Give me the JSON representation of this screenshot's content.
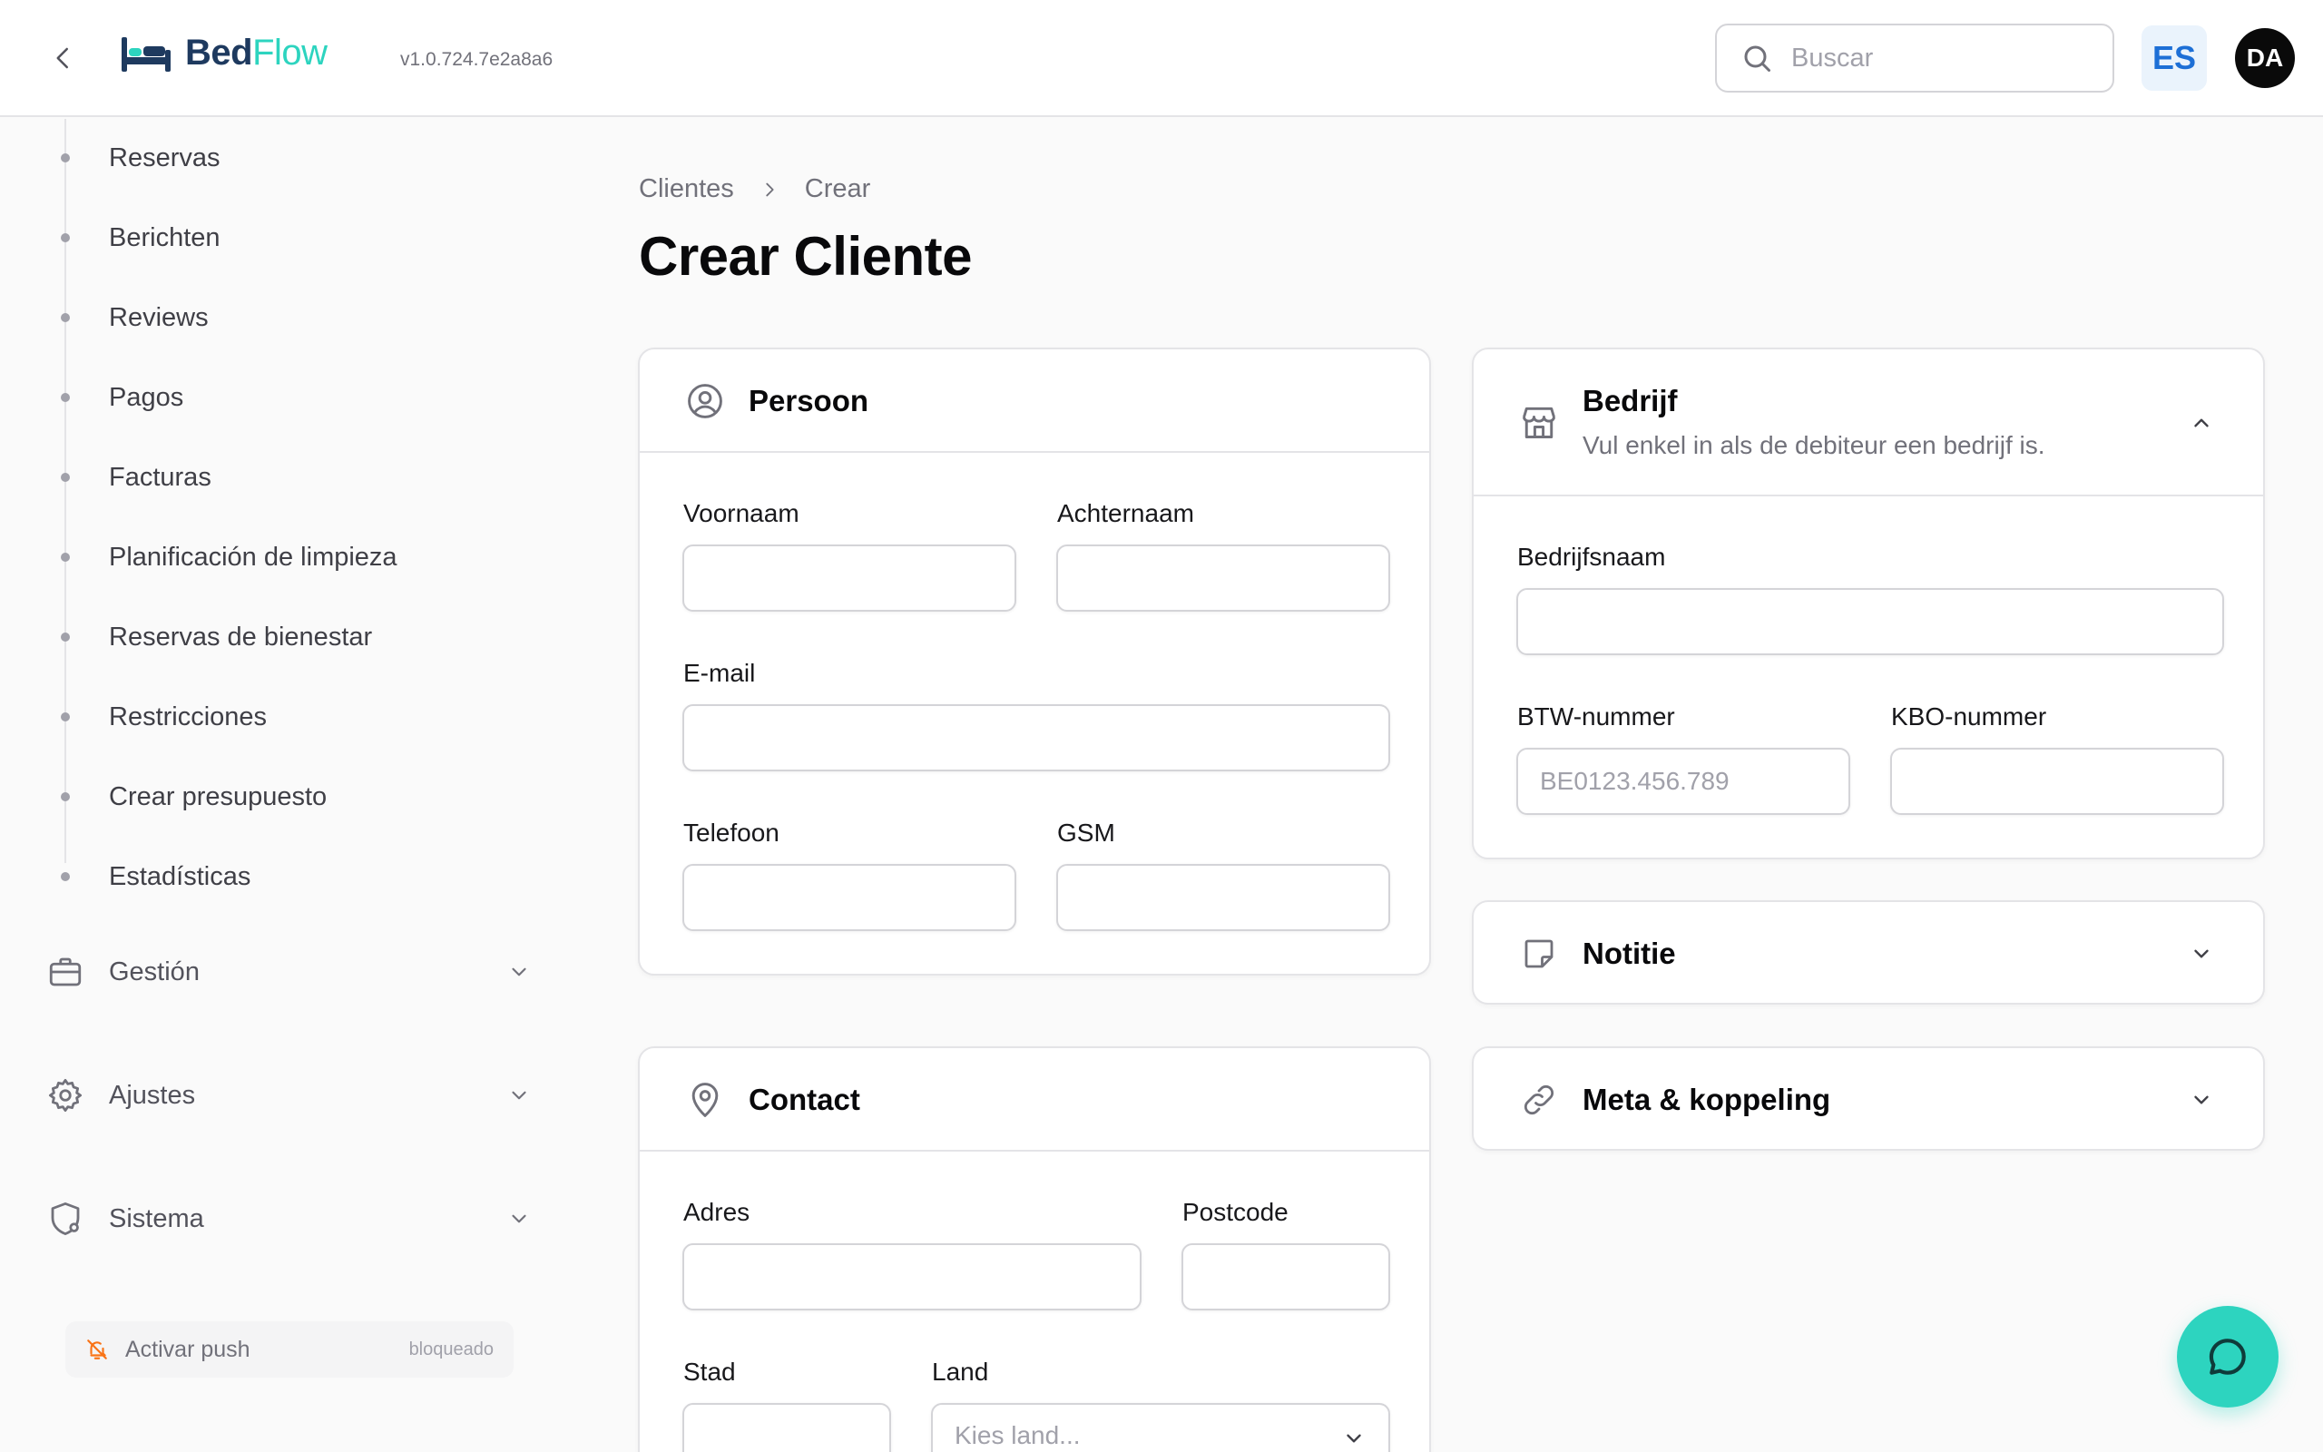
{
  "header": {
    "logo_part1": "Bed",
    "logo_part2": "Flow",
    "version": "v1.0.724.7e2a8a6",
    "search_placeholder": "Buscar",
    "language": "ES",
    "user_initials": "DA"
  },
  "sidebar": {
    "sub_items": [
      {
        "label": "Reservas"
      },
      {
        "label": "Berichten"
      },
      {
        "label": "Reviews"
      },
      {
        "label": "Pagos"
      },
      {
        "label": "Facturas"
      },
      {
        "label": "Planificación de limpieza"
      },
      {
        "label": "Reservas de bienestar"
      },
      {
        "label": "Restricciones"
      },
      {
        "label": "Crear presupuesto"
      },
      {
        "label": "Estadísticas"
      }
    ],
    "groups": [
      {
        "label": "Gestión",
        "icon": "briefcase-icon"
      },
      {
        "label": "Ajustes",
        "icon": "gear-icon"
      },
      {
        "label": "Sistema",
        "icon": "shield-gear-icon"
      }
    ],
    "push": {
      "label": "Activar push",
      "state": "bloqueado"
    }
  },
  "breadcrumb": {
    "parent": "Clientes",
    "current": "Crear"
  },
  "page_title": "Crear Cliente",
  "persoon": {
    "title": "Persoon",
    "fields": {
      "voornaam": {
        "label": "Voornaam",
        "value": ""
      },
      "achternaam": {
        "label": "Achternaam",
        "value": ""
      },
      "email": {
        "label": "E-mail",
        "value": ""
      },
      "telefoon": {
        "label": "Telefoon",
        "value": ""
      },
      "gsm": {
        "label": "GSM",
        "value": ""
      }
    }
  },
  "contact": {
    "title": "Contact",
    "fields": {
      "adres": {
        "label": "Adres",
        "value": ""
      },
      "postcode": {
        "label": "Postcode",
        "value": ""
      },
      "stad": {
        "label": "Stad",
        "value": ""
      },
      "land": {
        "label": "Land",
        "placeholder": "Kies land..."
      }
    }
  },
  "bedrijf": {
    "title": "Bedrijf",
    "subtitle": "Vul enkel in als de debiteur een bedrijf is.",
    "fields": {
      "bedrijfsnaam": {
        "label": "Bedrijfsnaam",
        "value": ""
      },
      "btw": {
        "label": "BTW-nummer",
        "placeholder": "BE0123.456.789"
      },
      "kbo": {
        "label": "KBO-nummer",
        "value": ""
      }
    }
  },
  "notitie": {
    "title": "Notitie"
  },
  "meta": {
    "title": "Meta & koppeling"
  },
  "colors": {
    "accent": "#2dd4bf",
    "brand_dark": "#1e3a5f",
    "lang_blue": "#1d6fd6"
  }
}
